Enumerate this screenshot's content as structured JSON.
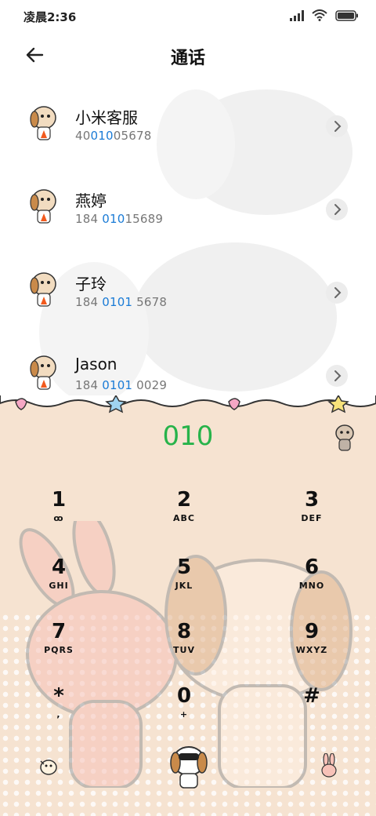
{
  "status": {
    "time": "凌晨2:36"
  },
  "header": {
    "title": "通话"
  },
  "contacts": [
    {
      "name": "小米客服",
      "num_pre": "40",
      "num_hl": "010",
      "num_post": "05678"
    },
    {
      "name": "燕婷",
      "num_pre": "184 ",
      "num_hl": "010",
      "num_post": "15689"
    },
    {
      "name": "子玲",
      "num_pre": "184 ",
      "num_hl": "0101",
      "num_post": " 5678"
    },
    {
      "name": "Jason",
      "num_pre": "184 ",
      "num_hl": "0101",
      "num_post": " 0029"
    }
  ],
  "dialer": {
    "input": "010",
    "keys": [
      {
        "digit": "1",
        "letters": "ꝏ"
      },
      {
        "digit": "2",
        "letters": "ABC"
      },
      {
        "digit": "3",
        "letters": "DEF"
      },
      {
        "digit": "4",
        "letters": "GHI"
      },
      {
        "digit": "5",
        "letters": "JKL"
      },
      {
        "digit": "6",
        "letters": "MNO"
      },
      {
        "digit": "7",
        "letters": "PQRS"
      },
      {
        "digit": "8",
        "letters": "TUV"
      },
      {
        "digit": "9",
        "letters": "WXYZ"
      },
      {
        "digit": "*",
        "letters": ","
      },
      {
        "digit": "0",
        "letters": "+"
      },
      {
        "digit": "#",
        "letters": ""
      }
    ]
  },
  "colors": {
    "accent_blue": "#1a7bd6",
    "dial_green": "#27b34a",
    "dialer_bg": "#f6e3d1"
  }
}
